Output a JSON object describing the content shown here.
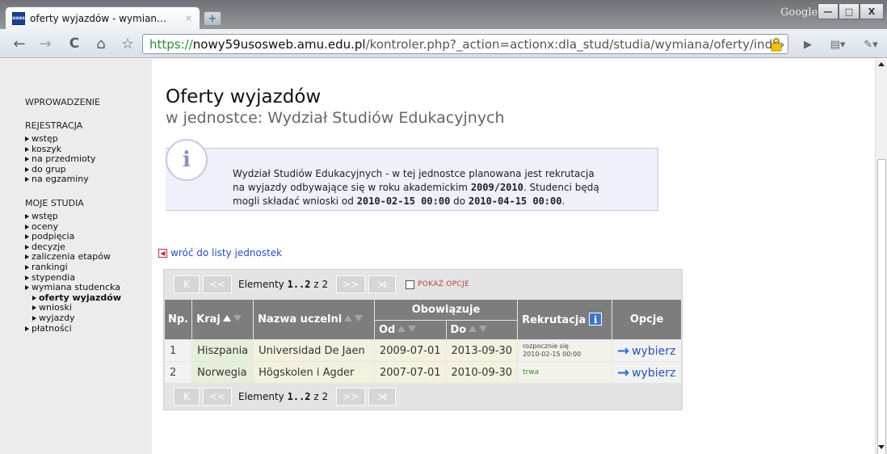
{
  "browser": {
    "tab_title": "oferty wyjazdów - wymian…",
    "tab_favicon_text": "usos",
    "tab_close": "×",
    "new_tab": "+",
    "window_label": "Google",
    "url_scheme": "https://",
    "url_host": "nowy59usosweb.amu.edu.pl",
    "url_path": "/kontroler.php?_action=actionx:dla_stud/studia/wymiana/oferty/inde›",
    "buttons": {
      "back": "←",
      "forward": "→",
      "reload": "C",
      "home": "⌂",
      "star": "☆",
      "minimize": "—",
      "maximize": "□",
      "close": "X",
      "play": "▶",
      "page": "▤▾",
      "wrench": "✎▾"
    }
  },
  "sidebar": {
    "intro": "WPROWADZENIE",
    "sections": [
      {
        "title": "REJESTRACJA",
        "items": [
          "wstęp",
          "koszyk",
          "na przedmioty",
          "do grup",
          "na egzaminy"
        ]
      },
      {
        "title": "MOJE STUDIA",
        "items": [
          "wstęp",
          "oceny",
          "podpięcia",
          "decyzje",
          "zaliczenia etapów",
          "rankingi",
          "stypendia",
          "wymiana studencka"
        ],
        "subitems": [
          "oferty wyjazdów",
          "wnioski",
          "wyjazdy"
        ],
        "after": [
          "płatności"
        ]
      }
    ]
  },
  "main": {
    "title": "Oferty wyjazdów",
    "subtitle": "w jednostce: Wydział Studiów Edukacyjnych",
    "info_icon": "i",
    "info": {
      "line1": "Wydział Studiów Edukacyjnych - w tej jednostce planowana jest rekrutacja",
      "line2_a": "na wyjazdy odbywające się w roku akademickim ",
      "line2_year": "2009/2010",
      "line2_b": ". Studenci będą",
      "line3_a": "mogli składać wnioski od ",
      "line3_from": "2010-02-15 00:00",
      "line3_b": " do ",
      "line3_to": "2010-04-15 00:00",
      "line3_c": "."
    },
    "back_link": "wróć do listy jednostek",
    "pager": {
      "first": "K",
      "prev": "<<",
      "next": ">>",
      "last": "⋊",
      "label_a": "Elementy ",
      "range": "1..2",
      "label_b": " z 2",
      "show_options": "POKAŻ OPCJE"
    },
    "table": {
      "headers": {
        "np": "Np.",
        "kraj": "Kraj",
        "uczelnia": "Nazwa uczelni",
        "obowiazuje": "Obowiązuje",
        "od": "Od",
        "do": "Do",
        "rekrutacja": "Rekrutacja",
        "opcje": "Opcje",
        "info_badge": "i"
      },
      "rows": [
        {
          "np": "1",
          "kraj": "Hiszpania",
          "uczelnia": "Universidad De Jaen",
          "od": "2009-07-01",
          "do": "2013-09-30",
          "rek1": "rozpocznie się",
          "rek2": "2010-02-15 00:00",
          "opcja": "wybierz"
        },
        {
          "np": "2",
          "kraj": "Norwegia",
          "uczelnia": "Högskolen i Agder",
          "od": "2007-07-01",
          "do": "2010-09-30",
          "rek1": "trwa",
          "rek2": "",
          "opcja": "wybierz"
        }
      ]
    }
  }
}
